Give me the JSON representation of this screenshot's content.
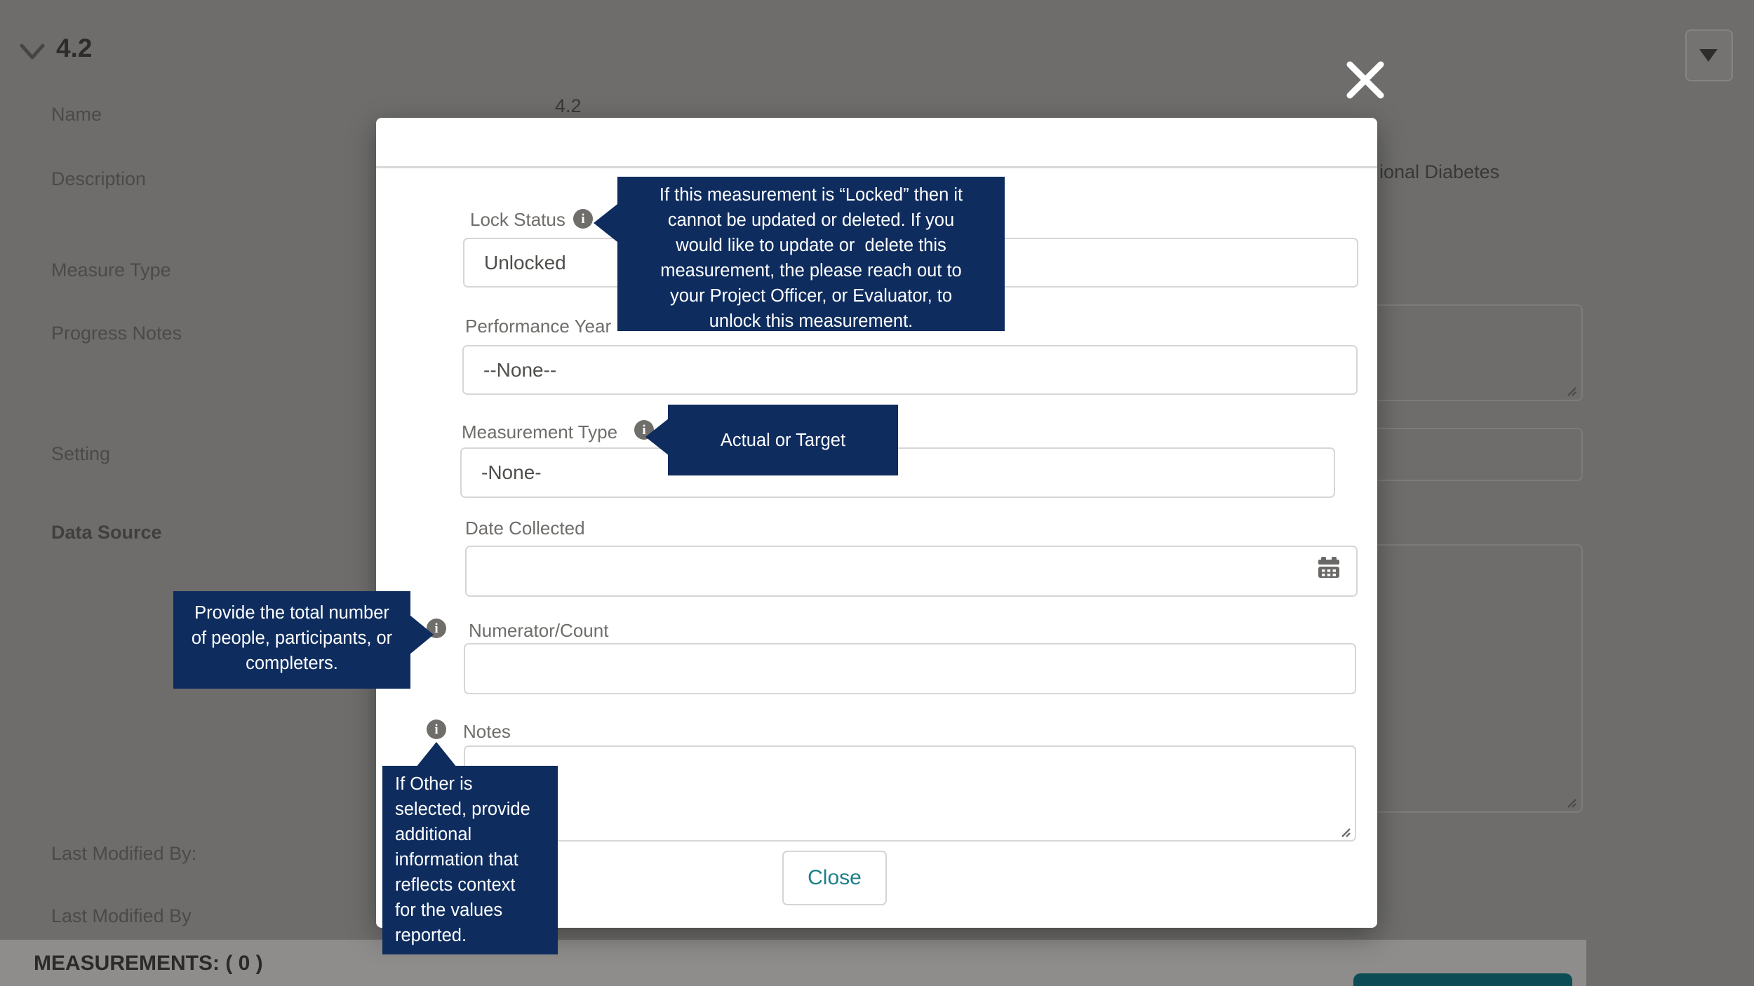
{
  "colors": {
    "backdrop_gray": "#6e6d6c",
    "tooltip_navy": "#0e2c5e",
    "close_button_text_teal": "#1d7f8a",
    "bottom_teal_button": "#0c4d55"
  },
  "background": {
    "section_title": "4.2",
    "name_label": "Name",
    "name_value": "4.2",
    "description_label": "Description",
    "description_value_visible": "ional Diabetes",
    "measure_type_label": "Measure Type",
    "progress_notes_label": "Progress Notes",
    "setting_label": "Setting",
    "data_source_label": "Data Source",
    "last_modified_by_colon": "Last Modified By:",
    "last_modified_by": "Last Modified By",
    "measurements_bar": "MEASUREMENTS: ( 0 )"
  },
  "modal": {
    "lock_status_label": "Lock Status",
    "lock_status_value": "Unlocked",
    "performance_year_label": "Performance Year",
    "performance_year_value": "--None--",
    "measurement_type_label": "Measurement Type",
    "measurement_type_value": "-None-",
    "date_collected_label": "Date Collected",
    "date_collected_value": "",
    "numerator_label": "Numerator/Count",
    "numerator_value": "",
    "notes_label": "Notes",
    "notes_value": "",
    "close_button": "Close"
  },
  "icons": {
    "info_glyph": "i"
  },
  "tooltips": {
    "lock_status": "If this measurement is “Locked” then it\ncannot be updated or deleted. If you\nwould like to update or  delete this\nmeasurement, the please reach out to\nyour Project Officer, or Evaluator, to\nunlock this measurement.",
    "measurement_type": "Actual or Target",
    "numerator": "Provide the total number\nof people, participants, or\ncompleters.",
    "notes": "If Other is\nselected, provide\nadditional\ninformation that\nreflects context\nfor the values\nreported."
  }
}
